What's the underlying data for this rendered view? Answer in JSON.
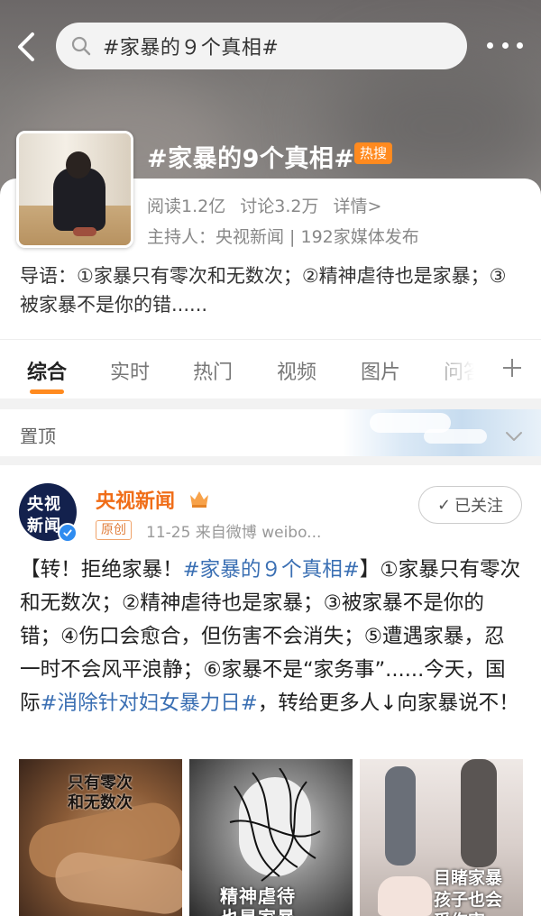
{
  "header": {
    "search_text": "#家暴的９个真相#"
  },
  "topic": {
    "title": "#家暴的9个真相#",
    "hot_badge": "热搜",
    "reads": "阅读1.2亿",
    "discussions": "讨论3.2万",
    "details_link": "详情>",
    "host": "主持人：央视新闻 | 192家媒体发布",
    "intro": "导语：①家暴只有零次和无数次；②精神虐待也是家暴；③被家暴不是你的错......"
  },
  "tabs": [
    {
      "label": "综合",
      "active": true
    },
    {
      "label": "实时",
      "active": false
    },
    {
      "label": "热门",
      "active": false
    },
    {
      "label": "视频",
      "active": false
    },
    {
      "label": "图片",
      "active": false
    },
    {
      "label": "问答",
      "active": false
    }
  ],
  "pinned": {
    "label": "置顶"
  },
  "post": {
    "avatar_text_line1": "央视",
    "avatar_text_line2": "新闻",
    "author": "央视新闻",
    "original_tag": "原创",
    "meta": "11-25  来自微博 weibo...",
    "follow_label": "已关注",
    "text_part1": "【转！拒绝家暴！",
    "hashtag1": "#家暴的９个真相#",
    "text_part2": "】①家暴只有零次和无数次；②精神虐待也是家暴；③被家暴不是你的错；④伤口会愈合，但伤害不会消失；⑤遭遇家暴，忍一时不会风平浪静；⑥家暴不是“家务事”......今天，国际",
    "hashtag2": "#消除针对妇女暴力日#",
    "text_part3": "，转给更多人↓向家暴说不！",
    "images": [
      {
        "caption": "只有零次\n和无数次"
      },
      {
        "caption": "精神虐待\n也是家暴"
      },
      {
        "caption": "目睹家暴\n孩子也会\n受伤害"
      }
    ]
  },
  "colors": {
    "accent_orange": "#ff8a1f",
    "author_orange": "#f06d18",
    "link_blue": "#3a6fb3"
  }
}
